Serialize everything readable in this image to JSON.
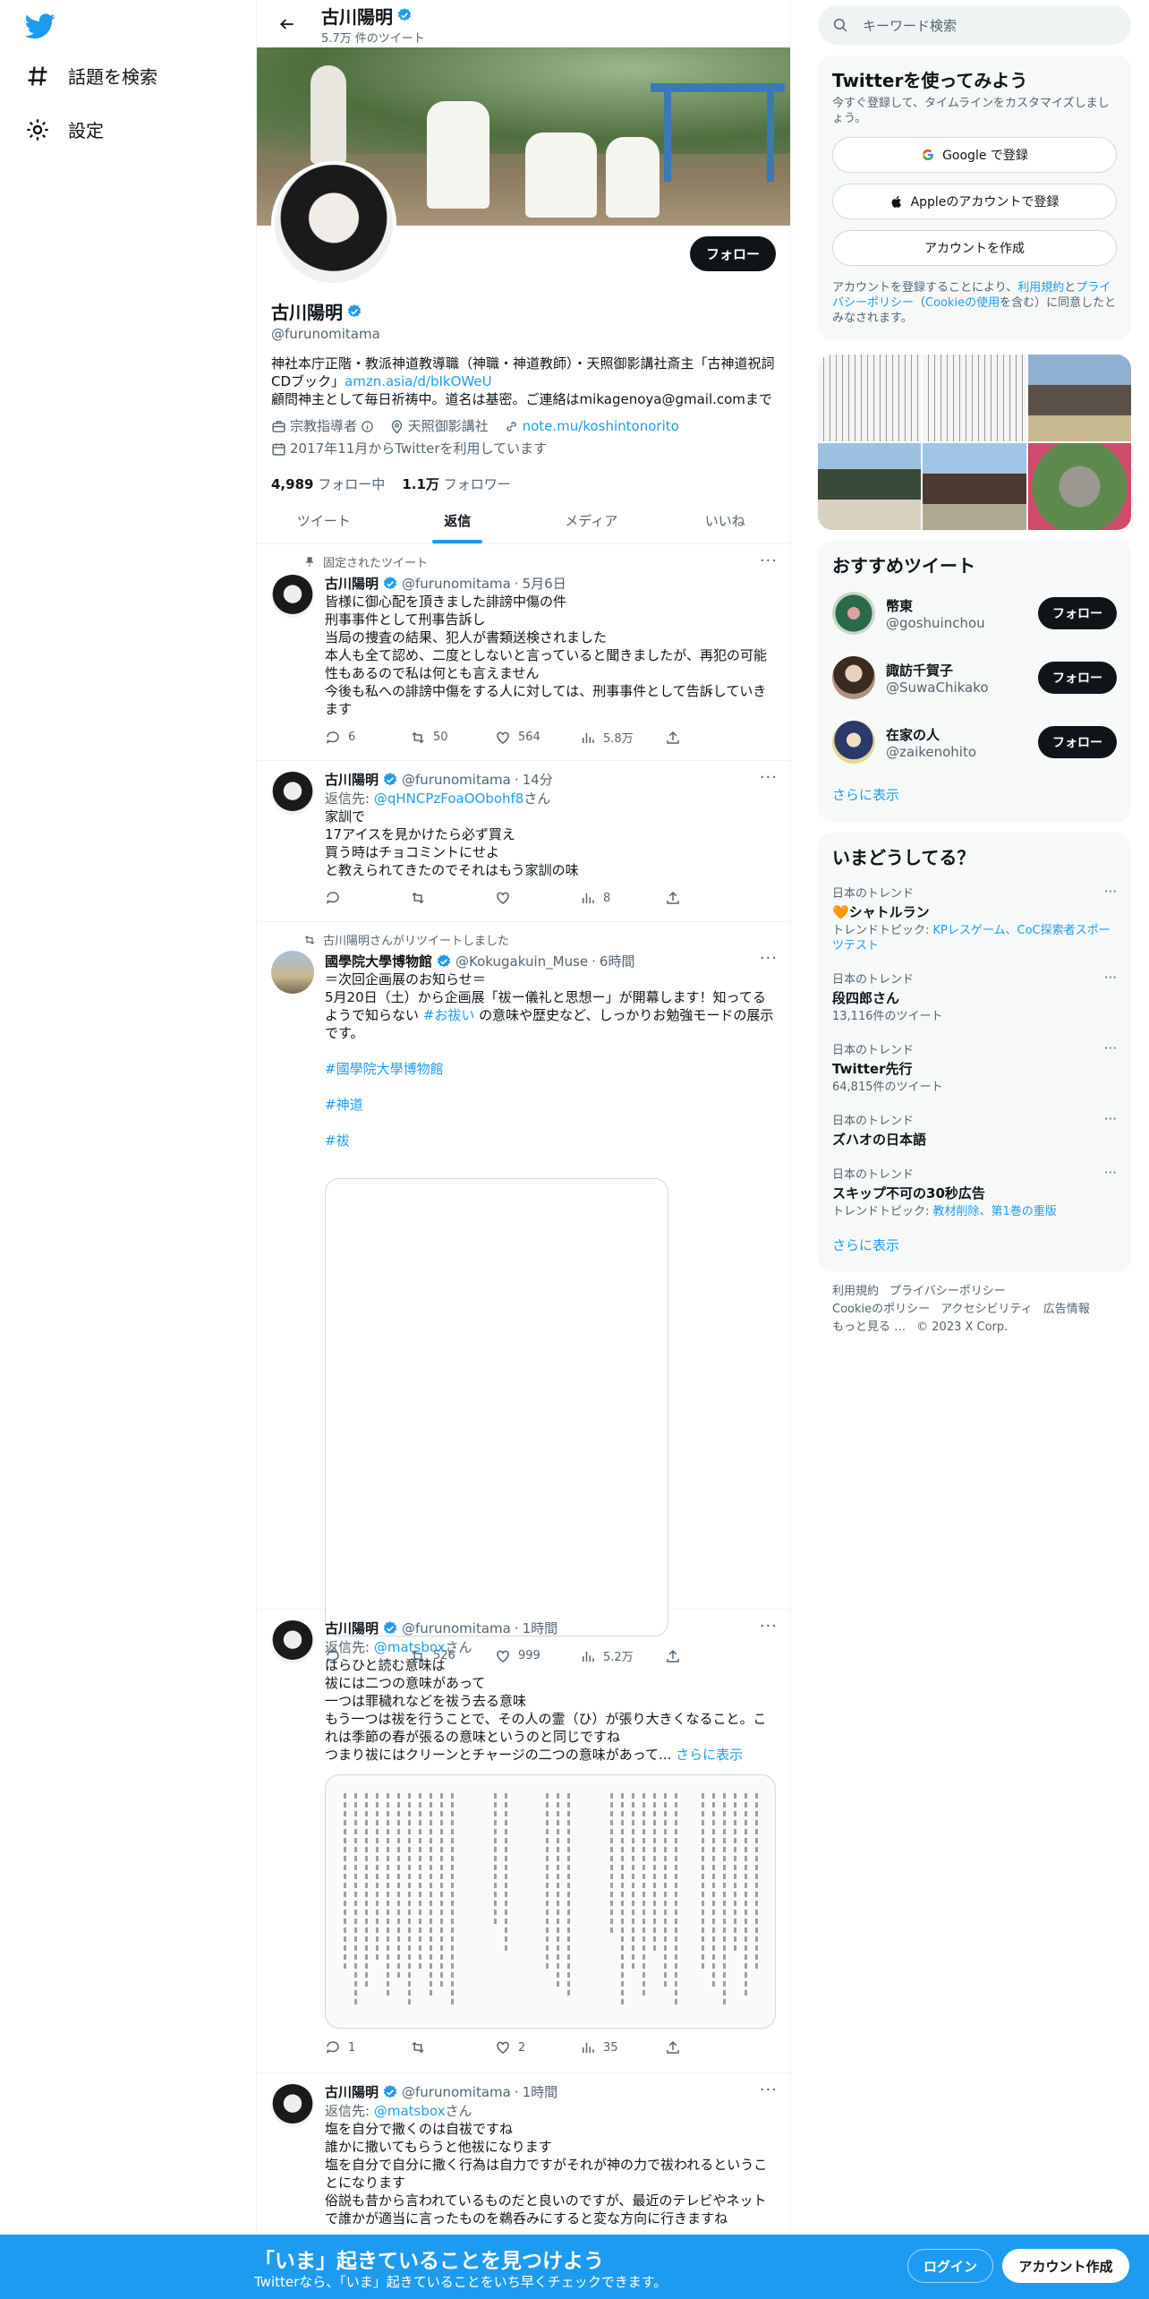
{
  "header": {
    "name": "古川陽明",
    "tweet_count": "5.7万 件のツイート"
  },
  "leftnav": {
    "explore": "話題を検索",
    "settings": "設定"
  },
  "profile": {
    "name": "古川陽明",
    "handle": "@furunomitama",
    "follow_label": "フォロー",
    "bio1": "神社本庁正階・教派神道教導職（神職・神道教師）・天照御影講社斎主「古神道祝詞CDブック」",
    "bio_link": "amzn.asia/d/bIkOWeU",
    "bio2": "顧問神主として毎日祈祷中。道名は基密。ご連絡はmikagenoya@gmail.comまで",
    "category": "宗教指導者",
    "location": "天照御影講社",
    "website": "note.mu/koshintonorito",
    "joined": "2017年11月からTwitterを利用しています",
    "following_count": "4,989",
    "following_label": "フォロー中",
    "followers_count": "1.1万",
    "followers_label": "フォロワー"
  },
  "tabs": [
    "ツイート",
    "返信",
    "メディア",
    "いいね"
  ],
  "tweets": [
    {
      "context": "固定されたツイート",
      "name": "古川陽明",
      "handle": "@furunomitama",
      "time": "5月6日",
      "text": "皆様に御心配を頂きました誹謗中傷の件\n刑事事件として刑事告訴し\n当局の捜査の結果、犯人が書類送検されました\n本人も全て認め、二度としないと言っていると聞きましたが、再犯の可能性もあるので私は何とも言えません\n今後も私への誹謗中傷をする人に対しては、刑事事件として告訴していきます",
      "reply": "6",
      "retweet": "50",
      "like": "564",
      "views": "5.8万"
    },
    {
      "name": "古川陽明",
      "handle": "@furunomitama",
      "time": "14分",
      "reply_prefix": "返信先: ",
      "reply_to": "@qHNCPzFoaOObohf8",
      "reply_suffix": "さん",
      "text": "家訓で\n17アイスを見かけたら必ず買え\n買う時はチョコミントにせよ\nと教えられてきたのでそれはもう家訓の味",
      "reply": "",
      "retweet": "",
      "like": "",
      "views": "8"
    },
    {
      "context": "古川陽明さんがリツイートしました",
      "name": "國學院大學博物館",
      "handle": "@Kokugakuin_Muse",
      "time": "6時間",
      "text1": "＝次回企画展のお知らせ＝\n5月20日（土）から企画展「祓ー儀礼と思想ー」が開幕します！知ってるようで知らない ",
      "hashtag_inline": "#お祓い",
      "text2": " の意味や歴史など、しっかりお勉強モードの展示です。",
      "hashtags": [
        "#國學院大學博物館",
        "#神道",
        "#祓"
      ],
      "reply": "",
      "retweet": "526",
      "like": "999",
      "views": "5.2万"
    },
    {
      "name": "古川陽明",
      "handle": "@furunomitama",
      "time": "1時間",
      "reply_prefix": "返信先: ",
      "reply_to": "@matsbox",
      "reply_suffix": "さん",
      "text": "はらひと読む意味は\n祓には二つの意味があって\n一つは罪穢れなどを祓う去る意味\nもう一つは祓を行うことで、その人の霊（ひ）が張り大きくなること。これは季節の春が張るの意味というのと同じですね\nつまり祓にはクリーンとチャージの二つの意味があって...",
      "show_more": "さらに表示",
      "reply": "1",
      "retweet": "",
      "like": "2",
      "views": "35"
    },
    {
      "name": "古川陽明",
      "handle": "@furunomitama",
      "time": "1時間",
      "reply_prefix": "返信先: ",
      "reply_to": "@matsbox",
      "reply_suffix": "さん",
      "text": "塩を自分で撒くのは自祓ですね\n誰かに撒いてもらうと他祓になります\n塩を自分で自分に撒く行為は自力ですがそれが神の力で祓われるということになります\n俗説も昔から言われているものだと良いのですが、最近のテレビやネットで誰かが適当に言ったものを鵜呑みにすると変な方向に行きますね"
    }
  ],
  "right": {
    "search_placeholder": "キーワード検索",
    "signup": {
      "title": "Twitterを使ってみよう",
      "sub": "今すぐ登録して、タイムラインをカスタマイズしましょう。",
      "google": "Google で登録",
      "apple": "Appleのアカウントで登録",
      "create": "アカウントを作成",
      "legal1": "アカウントを登録することにより、",
      "terms": "利用規約",
      "and": "と",
      "privacy": "プライバシーポリシー",
      "cookie_open": "（",
      "cookie": "Cookieの使用",
      "legal2": "を含む）に同意したとみなされます。"
    },
    "recommend": {
      "title": "おすすめツイート",
      "users": [
        {
          "name": "幣東",
          "handle": "@goshuinchou",
          "button": "フォロー"
        },
        {
          "name": "諏訪千賀子",
          "handle": "@SuwaChikako",
          "button": "フォロー"
        },
        {
          "name": "在家の人",
          "handle": "@zaikenohito",
          "button": "フォロー"
        }
      ],
      "more": "さらに表示"
    },
    "trends": {
      "title": "いまどうしてる？",
      "items": [
        {
          "context": "日本のトレンド",
          "name": "🧡シャトルラン",
          "extra_prefix": "トレンドトピック: ",
          "extra_links": "KPレスゲーム、CoC探索者スポーツテスト"
        },
        {
          "context": "日本のトレンド",
          "name": "段四郎さん",
          "extra": "13,116件のツイート"
        },
        {
          "context": "日本のトレンド",
          "name": "Twitter先行",
          "extra": "64,815件のツイート"
        },
        {
          "context": "日本のトレンド",
          "name": "ズハオの日本語"
        },
        {
          "context": "日本のトレンド",
          "name": "スキップ不可の30秒広告",
          "extra_prefix": "トレンドトピック: ",
          "extra_links": "教材削除、第1巻の重版"
        }
      ],
      "more": "さらに表示"
    },
    "footer": [
      "利用規約",
      "プライバシーポリシー",
      "Cookieのポリシー",
      "アクセシビリティ",
      "広告情報",
      "もっと見る …",
      "© 2023 X Corp."
    ]
  },
  "bottombar": {
    "title": "「いま」起きていることを見つけよう",
    "sub": "Twitterなら、「いま」起きていることをいち早くチェックできます。",
    "login": "ログイン",
    "signup": "アカウント作成"
  },
  "colors": {
    "brand": "#1d9bf0",
    "text": "#0f1419",
    "muted": "#536471"
  }
}
